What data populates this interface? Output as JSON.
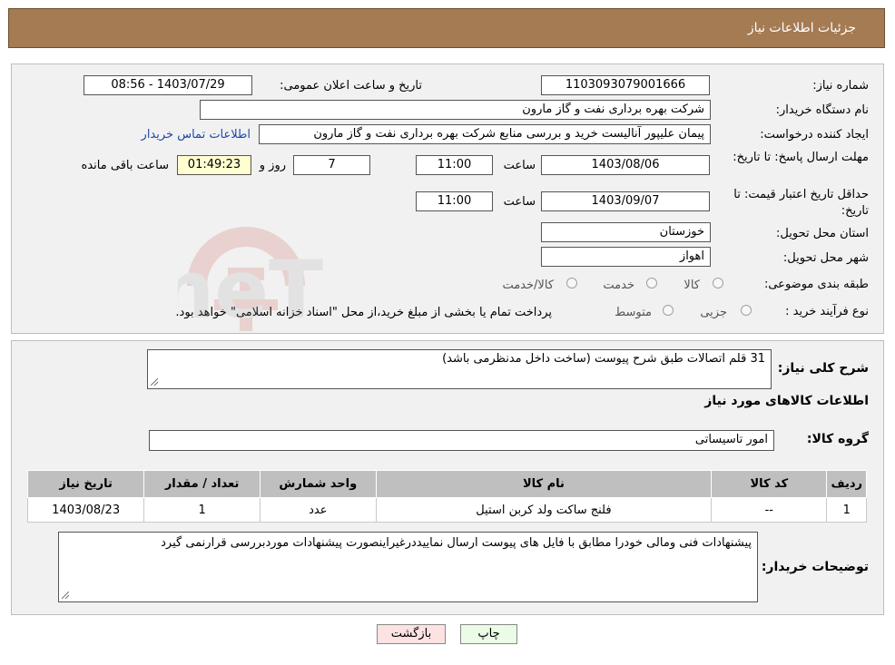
{
  "header": {
    "title": "جزئیات اطلاعات نیاز"
  },
  "form": {
    "need_number_label": "شماره نیاز:",
    "need_number": "1103093079001666",
    "announce_label": "تاریخ و ساعت اعلان عمومی:",
    "announce_value": "1403/07/29 - 08:56",
    "buyer_org_label": "نام دستگاه خریدار:",
    "buyer_org": "شرکت بهره برداری نفت و گاز مارون",
    "creator_label": "ایجاد کننده درخواست:",
    "creator": "پیمان علیپور آنالیست خرید و بررسی منابع شرکت بهره برداری نفت و گاز مارون",
    "contact_link": "اطلاعات تماس خریدار",
    "deadline_label": "مهلت ارسال پاسخ: تا تاریخ:",
    "deadline_date": "1403/08/06",
    "time_label": "ساعت",
    "deadline_time": "11:00",
    "days_value": "7",
    "days_label": "روز و",
    "remaining_time": "01:49:23",
    "remaining_label": "ساعت باقی مانده",
    "validity_label": "حداقل تاریخ اعتبار قیمت: تا تاریخ:",
    "validity_date": "1403/09/07",
    "validity_time": "11:00",
    "province_label": "استان محل تحویل:",
    "province": "خوزستان",
    "city_label": "شهر محل تحویل:",
    "city": "اهواز",
    "category_label": "طبقه بندی موضوعی:",
    "category_options": [
      "کالا",
      "خدمت",
      "کالا/خدمت"
    ],
    "process_label": "نوع فرآیند خرید :",
    "process_options": [
      "جزیی",
      "متوسط"
    ],
    "process_note": "پرداخت تمام یا بخشی از مبلغ خرید،از محل \"اسناد خزانه اسلامی\" خواهد بود."
  },
  "details": {
    "summary_label": "شرح کلی نیاز:",
    "summary": "31 قلم اتصالات طبق شرح پیوست (ساخت داخل مدنظرمی باشد)",
    "goods_info_title": "اطلاعات کالاهای مورد نیاز",
    "group_label": "گروه کالا:",
    "group": "امور تاسیساتی",
    "table": {
      "headers": [
        "ردیف",
        "کد کالا",
        "نام کالا",
        "واحد شمارش",
        "تعداد / مقدار",
        "تاریخ نیاز"
      ],
      "rows": [
        [
          "1",
          "--",
          "فلنج ساکت ولد کربن استیل",
          "عدد",
          "1",
          "1403/08/23"
        ]
      ]
    },
    "buyer_notes_label": "توضیحات خریدار:",
    "buyer_notes": "پیشنهادات فنی ومالی خودرا  مطابق با فایل های پیوست ارسال نماییددرغیراینصورت پیشنهادات موردبررسی قرارنمی گیرد"
  },
  "buttons": {
    "print": "چاپ",
    "back": "بازگشت"
  },
  "watermark": {
    "text": "AriaTender.neT"
  }
}
